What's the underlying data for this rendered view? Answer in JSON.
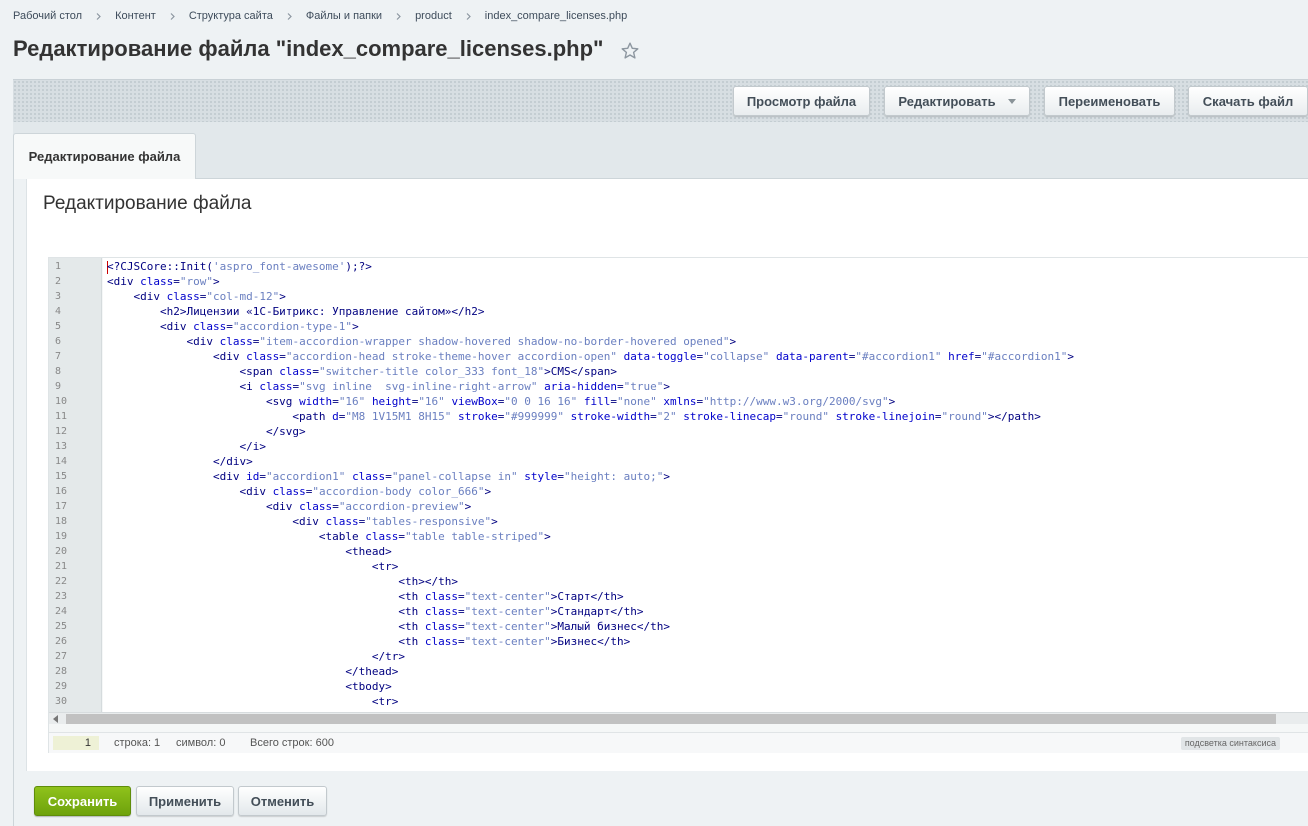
{
  "breadcrumb": [
    {
      "label": "Рабочий стол"
    },
    {
      "label": "Контент"
    },
    {
      "label": "Структура сайта"
    },
    {
      "label": "Файлы и папки"
    },
    {
      "label": "product"
    },
    {
      "label": "index_compare_licenses.php"
    }
  ],
  "page": {
    "title": "Редактирование файла \"index_compare_licenses.php\""
  },
  "toolbar": {
    "view_label": "Просмотр файла",
    "edit_label": "Редактировать",
    "rename_label": "Переименовать",
    "download_label": "Скачать файл"
  },
  "tabs": [
    {
      "label": "Редактирование файла"
    }
  ],
  "panel": {
    "title": "Редактирование файла"
  },
  "editor": {
    "line_numbers": [
      "1",
      "2",
      "3",
      "4",
      "5",
      "6",
      "7",
      "8",
      "9",
      "10",
      "11",
      "12",
      "13",
      "14",
      "15",
      "16",
      "17",
      "18",
      "19",
      "20",
      "21",
      "22",
      "23",
      "24",
      "25",
      "26",
      "27",
      "28",
      "29",
      "30"
    ],
    "lines": [
      [
        [
          "t",
          "<?CJSCore::Init("
        ],
        [
          "s",
          "'aspro_font-awesome'"
        ],
        [
          "t",
          ");?>"
        ]
      ],
      [
        [
          "t",
          "<div "
        ],
        [
          "a",
          "class"
        ],
        [
          "t",
          "="
        ],
        [
          "s",
          "\"row\""
        ],
        [
          "t",
          ">"
        ]
      ],
      [
        [
          "t",
          "    <div "
        ],
        [
          "a",
          "class"
        ],
        [
          "t",
          "="
        ],
        [
          "s",
          "\"col-md-12\""
        ],
        [
          "t",
          ">"
        ]
      ],
      [
        [
          "t",
          "        <h2>Лицензии «1С-Битрикс: Управление сайтом»</h2>"
        ]
      ],
      [
        [
          "t",
          "        <div "
        ],
        [
          "a",
          "class"
        ],
        [
          "t",
          "="
        ],
        [
          "s",
          "\"accordion-type-1\""
        ],
        [
          "t",
          ">"
        ]
      ],
      [
        [
          "t",
          "            <div "
        ],
        [
          "a",
          "class"
        ],
        [
          "t",
          "="
        ],
        [
          "s",
          "\"item-accordion-wrapper shadow-hovered shadow-no-border-hovered opened\""
        ],
        [
          "t",
          ">"
        ]
      ],
      [
        [
          "t",
          "                <div "
        ],
        [
          "a",
          "class"
        ],
        [
          "t",
          "="
        ],
        [
          "s",
          "\"accordion-head stroke-theme-hover accordion-open\""
        ],
        [
          "t",
          " "
        ],
        [
          "a",
          "data-toggle"
        ],
        [
          "t",
          "="
        ],
        [
          "s",
          "\"collapse\""
        ],
        [
          "t",
          " "
        ],
        [
          "a",
          "data-parent"
        ],
        [
          "t",
          "="
        ],
        [
          "s",
          "\"#accordion1\""
        ],
        [
          "t",
          " "
        ],
        [
          "a",
          "href"
        ],
        [
          "t",
          "="
        ],
        [
          "s",
          "\"#accordion1\""
        ],
        [
          "t",
          ">"
        ]
      ],
      [
        [
          "t",
          "                    <span "
        ],
        [
          "a",
          "class"
        ],
        [
          "t",
          "="
        ],
        [
          "s",
          "\"switcher-title color_333 font_18\""
        ],
        [
          "t",
          ">CMS</span>"
        ]
      ],
      [
        [
          "t",
          "                    <i "
        ],
        [
          "a",
          "class"
        ],
        [
          "t",
          "="
        ],
        [
          "s",
          "\"svg inline  svg-inline-right-arrow\""
        ],
        [
          "t",
          " "
        ],
        [
          "a",
          "aria-hidden"
        ],
        [
          "t",
          "="
        ],
        [
          "s",
          "\"true\""
        ],
        [
          "t",
          ">"
        ]
      ],
      [
        [
          "t",
          "                        <svg "
        ],
        [
          "a",
          "width"
        ],
        [
          "t",
          "="
        ],
        [
          "s",
          "\"16\""
        ],
        [
          "t",
          " "
        ],
        [
          "a",
          "height"
        ],
        [
          "t",
          "="
        ],
        [
          "s",
          "\"16\""
        ],
        [
          "t",
          " "
        ],
        [
          "a",
          "viewBox"
        ],
        [
          "t",
          "="
        ],
        [
          "s",
          "\"0 0 16 16\""
        ],
        [
          "t",
          " "
        ],
        [
          "a",
          "fill"
        ],
        [
          "t",
          "="
        ],
        [
          "s",
          "\"none\""
        ],
        [
          "t",
          " "
        ],
        [
          "a",
          "xmlns"
        ],
        [
          "t",
          "="
        ],
        [
          "s",
          "\"http://www.w3.org/2000/svg\""
        ],
        [
          "t",
          ">"
        ]
      ],
      [
        [
          "t",
          "                            <path "
        ],
        [
          "a",
          "d"
        ],
        [
          "t",
          "="
        ],
        [
          "s",
          "\"M8 1V15M1 8H15\""
        ],
        [
          "t",
          " "
        ],
        [
          "a",
          "stroke"
        ],
        [
          "t",
          "="
        ],
        [
          "s",
          "\"#999999\""
        ],
        [
          "t",
          " "
        ],
        [
          "a",
          "stroke-width"
        ],
        [
          "t",
          "="
        ],
        [
          "s",
          "\"2\""
        ],
        [
          "t",
          " "
        ],
        [
          "a",
          "stroke-linecap"
        ],
        [
          "t",
          "="
        ],
        [
          "s",
          "\"round\""
        ],
        [
          "t",
          " "
        ],
        [
          "a",
          "stroke-linejoin"
        ],
        [
          "t",
          "="
        ],
        [
          "s",
          "\"round\""
        ],
        [
          "t",
          "></path>"
        ]
      ],
      [
        [
          "t",
          "                        </svg>"
        ]
      ],
      [
        [
          "t",
          "                    </i>"
        ]
      ],
      [
        [
          "t",
          "                </div>"
        ]
      ],
      [
        [
          "t",
          "                <div "
        ],
        [
          "a",
          "id"
        ],
        [
          "t",
          "="
        ],
        [
          "s",
          "\"accordion1\""
        ],
        [
          "t",
          " "
        ],
        [
          "a",
          "class"
        ],
        [
          "t",
          "="
        ],
        [
          "s",
          "\"panel-collapse in\""
        ],
        [
          "t",
          " "
        ],
        [
          "a",
          "style"
        ],
        [
          "t",
          "="
        ],
        [
          "s",
          "\"height: auto;\""
        ],
        [
          "t",
          ">"
        ]
      ],
      [
        [
          "t",
          "                    <div "
        ],
        [
          "a",
          "class"
        ],
        [
          "t",
          "="
        ],
        [
          "s",
          "\"accordion-body color_666\""
        ],
        [
          "t",
          ">"
        ]
      ],
      [
        [
          "t",
          "                        <div "
        ],
        [
          "a",
          "class"
        ],
        [
          "t",
          "="
        ],
        [
          "s",
          "\"accordion-preview\""
        ],
        [
          "t",
          ">"
        ]
      ],
      [
        [
          "t",
          "                            <div "
        ],
        [
          "a",
          "class"
        ],
        [
          "t",
          "="
        ],
        [
          "s",
          "\"tables-responsive\""
        ],
        [
          "t",
          ">"
        ]
      ],
      [
        [
          "t",
          "                                <table "
        ],
        [
          "a",
          "class"
        ],
        [
          "t",
          "="
        ],
        [
          "s",
          "\"table table-striped\""
        ],
        [
          "t",
          ">"
        ]
      ],
      [
        [
          "t",
          "                                    <thead>"
        ]
      ],
      [
        [
          "t",
          "                                        <tr>"
        ]
      ],
      [
        [
          "t",
          "                                            <th></th>"
        ]
      ],
      [
        [
          "t",
          "                                            <th "
        ],
        [
          "a",
          "class"
        ],
        [
          "t",
          "="
        ],
        [
          "s",
          "\"text-center\""
        ],
        [
          "t",
          ">Старт</th>"
        ]
      ],
      [
        [
          "t",
          "                                            <th "
        ],
        [
          "a",
          "class"
        ],
        [
          "t",
          "="
        ],
        [
          "s",
          "\"text-center\""
        ],
        [
          "t",
          ">Стандарт</th>"
        ]
      ],
      [
        [
          "t",
          "                                            <th "
        ],
        [
          "a",
          "class"
        ],
        [
          "t",
          "="
        ],
        [
          "s",
          "\"text-center\""
        ],
        [
          "t",
          ">Малый бизнес</th>"
        ]
      ],
      [
        [
          "t",
          "                                            <th "
        ],
        [
          "a",
          "class"
        ],
        [
          "t",
          "="
        ],
        [
          "s",
          "\"text-center\""
        ],
        [
          "t",
          ">Бизнес</th>"
        ]
      ],
      [
        [
          "t",
          "                                        </tr>"
        ]
      ],
      [
        [
          "t",
          "                                    </thead>"
        ]
      ],
      [
        [
          "t",
          "                                    <tbody>"
        ]
      ],
      [
        [
          "t",
          "                                        <tr>"
        ]
      ]
    ]
  },
  "status": {
    "current_line": "1",
    "position": "строка: 1",
    "char": "символ: 0",
    "total": "Всего строк: 600",
    "highlight_toggle": "подсветка синтаксиса"
  },
  "actions": {
    "save_label": "Сохранить",
    "apply_label": "Применить",
    "cancel_label": "Отменить"
  },
  "colors": {
    "save_accent": "#7ab014",
    "code_tag": "#000080",
    "code_attr": "#0000cc",
    "code_string": "#6a7fc0"
  }
}
